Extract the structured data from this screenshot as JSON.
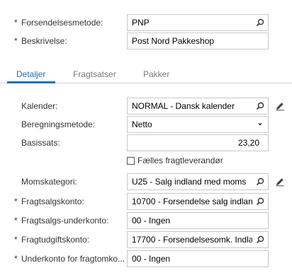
{
  "header": {
    "shipment_method": {
      "label": "Forsendelsesmetode:",
      "required": "*",
      "value": "PNP"
    },
    "description": {
      "label": "Beskrivelse:",
      "required": "*",
      "value": "Post Nord Pakkeshop"
    }
  },
  "tabs": [
    {
      "label": "Detaljer",
      "active": true
    },
    {
      "label": "Fragtsatser",
      "active": false
    },
    {
      "label": "Pakker",
      "active": false
    }
  ],
  "details": {
    "calendar": {
      "label": "Kalender:",
      "value": "NORMAL - Dansk kalender"
    },
    "calc_method": {
      "label": "Beregningsmetode:",
      "value": "Netto"
    },
    "base_rate": {
      "label": "Basissats:",
      "value": "23,20"
    },
    "common_carrier": {
      "label": "Fælles fragtleverandør",
      "checked": false
    },
    "tax_category": {
      "label": "Momskategori:",
      "value": "U25 - Salg indland med moms"
    },
    "freight_sales_account": {
      "label": "Fragtsalgskonto:",
      "required": "*",
      "value": "10700 - Forsendelse salg indlan"
    },
    "freight_sales_subaccount": {
      "label": "Fragtsalgs-underkonto:",
      "required": "*",
      "value": "00 - Ingen"
    },
    "freight_expense_account": {
      "label": "Fragtudgiftskonto:",
      "required": "*",
      "value": "17700 - Forsendelsesomk. Indla"
    },
    "freight_expense_subaccount": {
      "label": "Underkonto for fragtomko...",
      "required": "*",
      "value": "00 - Ingen"
    }
  },
  "icons": {
    "search": "search-icon",
    "edit": "pencil-icon",
    "dropdown": "chevron-down-icon"
  },
  "colors": {
    "accent": "#1a6fc4",
    "border": "#c8c8c8"
  }
}
